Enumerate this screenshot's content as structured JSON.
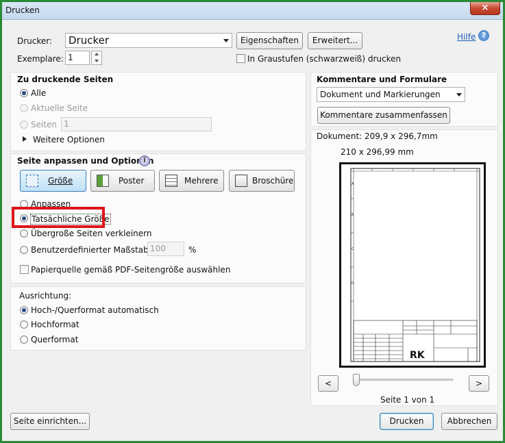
{
  "window": {
    "title": "Drucken",
    "close_glyph": "×"
  },
  "help": {
    "label": "Hilfe",
    "icon": "help-icon"
  },
  "printer": {
    "label": "Drucker:",
    "value": "Drucker",
    "properties_button": "Eigenschaften",
    "advanced_button": "Erweitert...",
    "copies_label": "Exemplare:",
    "copies_value": "1",
    "grayscale_label": "In Graustufen (schwarzweiß) drucken"
  },
  "pages": {
    "heading": "Zu druckende Seiten",
    "all": "Alle",
    "current": "Aktuelle Seite",
    "pages": "Seiten",
    "pages_value": "1",
    "more_options": "Weitere Optionen"
  },
  "sizing": {
    "heading": "Seite anpassen und Optionen",
    "info_icon": "info-icon",
    "buttons": [
      "Größe",
      "Poster",
      "Mehrere",
      "Broschüre"
    ],
    "fit": "Anpassen",
    "actual": "Tatsächliche Größe",
    "shrink": "Übergroße Seiten verkleinern",
    "custom_scale": "Benutzerdefinierter Maßstab:",
    "custom_scale_value": "100",
    "percent": "%",
    "paper_source": "Papierquelle gemäß PDF-Seitengröße auswählen"
  },
  "orientation": {
    "heading": "Ausrichtung:",
    "auto": "Hoch-/Querformat automatisch",
    "portrait": "Hochformat",
    "landscape": "Querformat"
  },
  "comments": {
    "heading": "Kommentare und Formulare",
    "value": "Dokument und Markierungen",
    "summarize_button": "Kommentare zusammenfassen"
  },
  "preview": {
    "document_size": "Dokument: 209,9 x 296,7mm",
    "page_size": "210 x 296,99 mm",
    "prev": "<",
    "next": ">",
    "page_counter": "Seite 1 von 1",
    "logo_text": "RK",
    "row_labels": [
      "A",
      "B",
      "C",
      "D"
    ]
  },
  "footer": {
    "setup_button": "Seite einrichten...",
    "print_button": "Drucken",
    "cancel_button": "Abbrechen"
  }
}
